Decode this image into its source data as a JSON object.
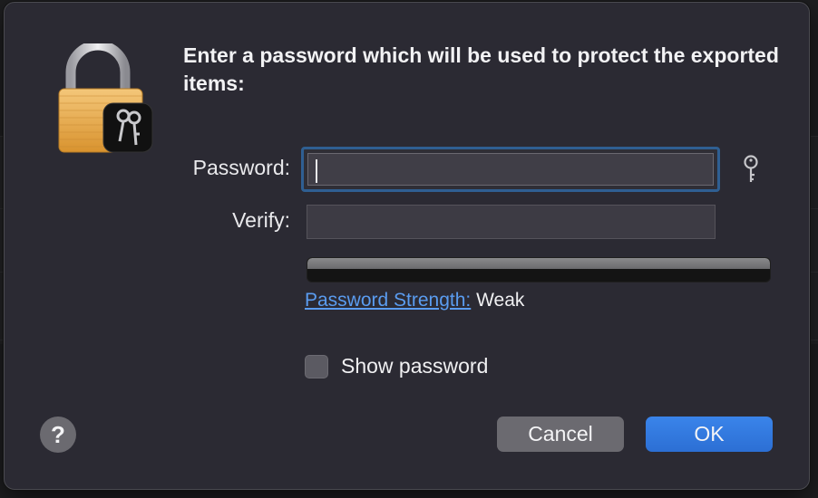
{
  "dialog": {
    "title": "Enter a password which will be used to protect the exported items:",
    "icon": "keychain-lock-icon"
  },
  "password": {
    "label": "Password:",
    "value": "",
    "key_icon": "key-icon"
  },
  "verify": {
    "label": "Verify:",
    "value": ""
  },
  "strength": {
    "link_label": "Password Strength:",
    "value": "Weak",
    "level": 0
  },
  "show_password": {
    "label": "Show password",
    "checked": false
  },
  "buttons": {
    "help": "?",
    "cancel": "Cancel",
    "ok": "OK"
  },
  "colors": {
    "accent": "#2c6fd4",
    "link": "#5a9cf0",
    "dialog_bg": "#2b2a33"
  }
}
